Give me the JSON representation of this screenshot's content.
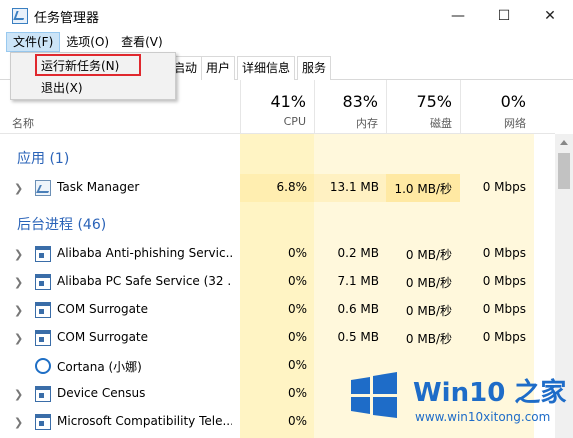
{
  "window": {
    "title": "任务管理器",
    "buttons": [
      "—",
      "☐",
      "✕"
    ]
  },
  "menu": {
    "file": "文件(F)",
    "options": "选项(O)",
    "view": "查看(V)"
  },
  "dropdown": {
    "run_new_task": "运行新任务(N)",
    "exit": "退出(X)"
  },
  "tabs": [
    "启动",
    "用户",
    "详细信息",
    "服务"
  ],
  "columns": {
    "name": "名称",
    "cpu": {
      "percent": "41%",
      "label": "CPU"
    },
    "memory": {
      "percent": "83%",
      "label": "内存"
    },
    "disk": {
      "percent": "75%",
      "label": "磁盘"
    },
    "network": {
      "percent": "0%",
      "label": "网络"
    }
  },
  "groups": {
    "apps": "应用 (1)",
    "background": "后台进程 (46)"
  },
  "rows": [
    {
      "name": "Task Manager",
      "cpu": "6.8%",
      "memory": "13.1 MB",
      "disk": "1.0 MB/秒",
      "network": "0 Mbps"
    },
    {
      "name": "Alibaba Anti-phishing Servic...",
      "cpu": "0%",
      "memory": "0.2 MB",
      "disk": "0 MB/秒",
      "network": "0 Mbps"
    },
    {
      "name": "Alibaba PC Safe Service (32 ...",
      "cpu": "0%",
      "memory": "7.1 MB",
      "disk": "0 MB/秒",
      "network": "0 Mbps"
    },
    {
      "name": "COM Surrogate",
      "cpu": "0%",
      "memory": "0.6 MB",
      "disk": "0 MB/秒",
      "network": "0 Mbps"
    },
    {
      "name": "COM Surrogate",
      "cpu": "0%",
      "memory": "0.5 MB",
      "disk": "0 MB/秒",
      "network": "0 Mbps"
    },
    {
      "name": "Cortana (小娜)",
      "cpu": "0%",
      "memory": "",
      "disk": "",
      "network": ""
    },
    {
      "name": "Device Census",
      "cpu": "0%",
      "memory": "",
      "disk": "",
      "network": ""
    },
    {
      "name": "Microsoft Compatibility Tele...",
      "cpu": "0%",
      "memory": "",
      "disk": "",
      "network": ""
    }
  ],
  "watermark": {
    "brand": "Win10 之家",
    "url": "www.win10xitong.com"
  },
  "colors": {
    "accent": "#2a63b8",
    "highlight_border": "#e0282e",
    "cpu_bg": "#fff4c4",
    "col_bg": "#fff8dc",
    "disk_row_bg": "#ffe9a3"
  }
}
